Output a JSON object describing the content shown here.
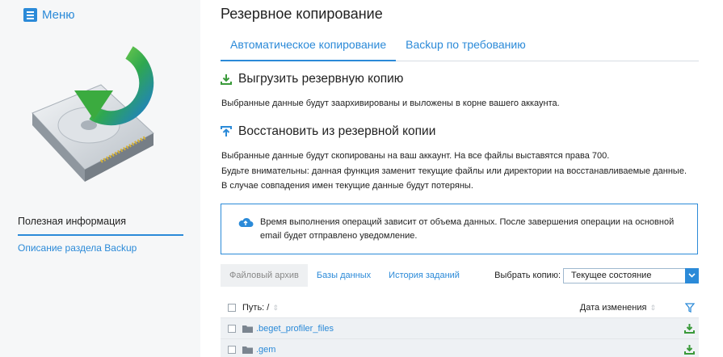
{
  "sidebar": {
    "menu_label": "Меню",
    "useful_title": "Полезная информация",
    "useful_link": "Описание раздела Backup"
  },
  "main": {
    "title": "Резервное копирование",
    "tabs": [
      {
        "label": "Автоматическое копирование",
        "active": true
      },
      {
        "label": "Backup по требованию",
        "active": false
      }
    ],
    "upload": {
      "heading": "Выгрузить резервную копию",
      "text": "Выбранные данные будут заархивированы и выложены в корне вашего аккаунта."
    },
    "restore": {
      "heading": "Восстановить из резервной копии",
      "lines": [
        "Выбранные данные будут скопированы на ваш аккаунт. На все файлы выставятся права 700.",
        "Будьте внимательны: данная функция заменит текущие файлы или директории на восстанавливаемые данные.",
        "В случае совпадения имен текущие данные будут потеряны."
      ]
    },
    "notice": "Время выполнения операций зависит от объема данных. После завершения операции на основной email будет отправлено уведомление.",
    "filter_tabs": [
      {
        "label": "Файловый архив",
        "active": true
      },
      {
        "label": "Базы данных",
        "active": false
      },
      {
        "label": "История заданий",
        "active": false
      }
    ],
    "select_label": "Выбрать копию:",
    "select_value": "Текущее состояние",
    "table": {
      "col_path": "Путь: /",
      "col_date": "Дата изменения",
      "rows": [
        {
          "name": ".beget_profiler_files"
        },
        {
          "name": ".gem"
        }
      ]
    }
  },
  "colors": {
    "accent": "#2b8ad8",
    "download": "#3a9a3a"
  }
}
